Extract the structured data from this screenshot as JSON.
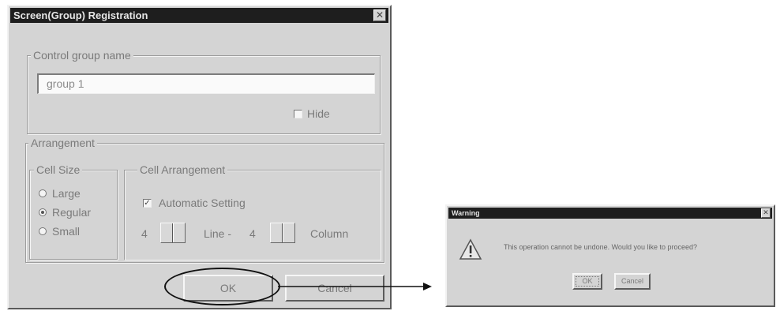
{
  "dialog": {
    "title": "Screen(Group) Registration",
    "close_glyph": "✕",
    "name_group": {
      "label": "Control group name",
      "value": "group 1",
      "hide_label": "Hide",
      "hide_checked": false
    },
    "arrangement": {
      "label": "Arrangement",
      "cell_size": {
        "label": "Cell Size",
        "options": [
          "Large",
          "Regular",
          "Small"
        ],
        "selected": "Regular"
      },
      "cell_arrangement": {
        "label": "Cell Arrangement",
        "auto_label": "Automatic Setting",
        "auto_checked": true,
        "line_value": "4",
        "line_label": "Line -",
        "column_value": "4",
        "column_label": "Column"
      }
    },
    "ok_label": "OK",
    "cancel_label": "Cancel"
  },
  "warning": {
    "title": "Warning",
    "close_glyph": "✕",
    "icon": "warning-icon",
    "message": "This operation cannot be undone. Would you like to proceed?",
    "ok_label": "OK",
    "cancel_label": "Cancel"
  },
  "colors": {
    "dialog_face": "#d4d4d4",
    "titlebar": "#1e1e1e",
    "annotation": "#111111"
  }
}
